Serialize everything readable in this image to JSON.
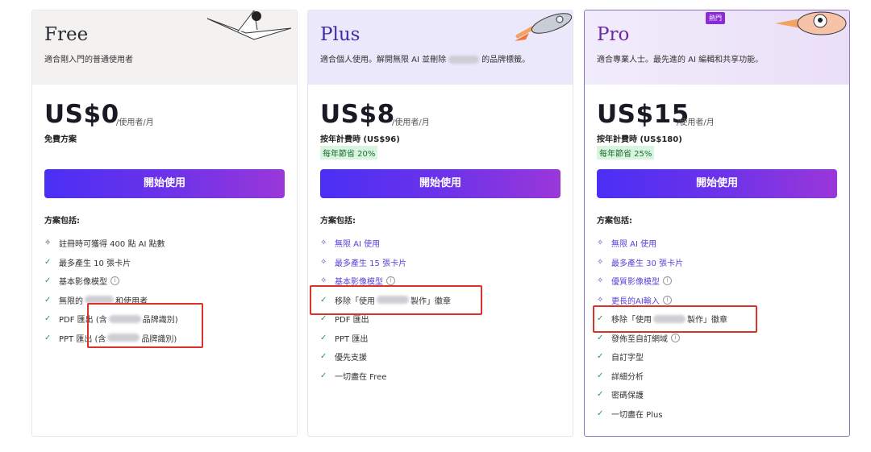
{
  "free": {
    "name": "Free",
    "desc": "適合剛入門的普通使用者",
    "price": "US$0",
    "per": "/使用者/月",
    "sub": "免費方案",
    "cta": "開始使用",
    "includes": "方案包括:",
    "f1": "註冊時可獲得 400 點 AI 點數",
    "f2": "最多產生 10 張卡片",
    "f3": "基本影像模型",
    "f4a": "無限的",
    "f4b": "和使用者",
    "f5a": "PDF 匯出 (含",
    "f5b": "品牌識別)",
    "f6a": "PPT 匯出 (含",
    "f6b": "品牌識別)"
  },
  "plus": {
    "name": "Plus",
    "desc_a": "適合個人使用。解開無限 AI 並刪除",
    "desc_b": "的品牌標籤。",
    "price": "US$8",
    "per": "/使用者/月",
    "sub": "按年計費時 (US$96)",
    "save": "每年節省 20%",
    "cta": "開始使用",
    "includes": "方案包括:",
    "f1": "無限 AI 使用",
    "f2": "最多產生 15 張卡片",
    "f3": "基本影像模型",
    "f4a": "移除「使用",
    "f4b": "製作」徽章",
    "f5": "PDF 匯出",
    "f6": "PPT 匯出",
    "f7": "優先支援",
    "f8": "一切盡在 Free"
  },
  "pro": {
    "badge": "熱門",
    "name": "Pro",
    "desc": "適合專業人士。最先進的 AI 編輯和共享功能。",
    "price": "US$15",
    "per": "/使用者/月",
    "sub": "按年計費時 (US$180)",
    "save": "每年節省 25%",
    "cta": "開始使用",
    "includes": "方案包括:",
    "f1": "無限 AI 使用",
    "f2": "最多產生 30 張卡片",
    "f3": "優質影像模型",
    "f4": "更長的AI輸入",
    "f5a": "移除「使用",
    "f5b": "製作」徽章",
    "f6": "發佈至自訂網域",
    "f7": "自訂字型",
    "f8": "詳細分析",
    "f9": "密碼保護",
    "f10": "一切盡在 Plus"
  },
  "colors": {
    "cta_start": "#4a2ff5",
    "cta_end": "#9a37d9",
    "premium": "#5b3fd6",
    "check": "#2e9a4f",
    "annotation": "#d9332b"
  }
}
